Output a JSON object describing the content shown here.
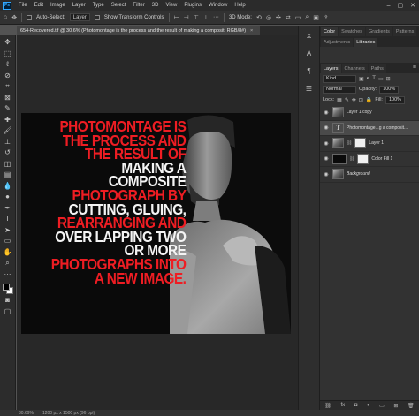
{
  "app": {
    "logo": "Ps"
  },
  "menu": [
    "File",
    "Edit",
    "Image",
    "Layer",
    "Type",
    "Select",
    "Filter",
    "3D",
    "View",
    "Plugins",
    "Window",
    "Help"
  ],
  "window_controls": {
    "minimize": "–",
    "maximize": "▢",
    "close": "✕"
  },
  "options_bar": {
    "auto_select_label": "Auto-Select:",
    "auto_select_value": "Layer",
    "show_transform": "Show Transform Controls",
    "mode_3d": "3D Mode:"
  },
  "document_tab": {
    "title": "654-Recovered.tif @ 30.6% (Photomontage is the process and the result of making a composit, RGB/8#)",
    "close": "×"
  },
  "poster": {
    "lines": [
      "PHOTOMONTAGE IS",
      "THE PROCESS AND",
      "THE RESULT OF",
      "MAKING A",
      "COMPOSITE",
      "PHOTOGRAPH BY",
      "CUTTING, GLUING,",
      "REARRANGING AND",
      "OVER LAPPING TWO",
      "OR MORE",
      "PHOTOGRAPHS INTO",
      "A NEW IMAGE."
    ]
  },
  "status": {
    "zoom": "30.69%",
    "size": "1200 px x 1500 px (96 ppi)"
  },
  "panel_top": {
    "tabs": [
      "Color",
      "Swatches",
      "Gradients",
      "Patterns"
    ],
    "subtabs": [
      "Adjustments",
      "Libraries"
    ]
  },
  "layers_panel": {
    "tabs": [
      "Layers",
      "Channels",
      "Paths"
    ],
    "kind": "Kind",
    "blend_mode": "Normal",
    "opacity_label": "Opacity:",
    "opacity_value": "100%",
    "lock_label": "Lock:",
    "fill_label": "Fill:",
    "fill_value": "100%",
    "layers": [
      {
        "name": "Layer 1 copy",
        "thumb": "photo",
        "selected": false
      },
      {
        "name": "Photomontage...g a composit...",
        "thumb": "text",
        "selected": true
      },
      {
        "name": "Layer 1",
        "thumb": "photo-mask",
        "selected": false
      },
      {
        "name": "Color Fill 1",
        "thumb": "black-mask",
        "selected": false
      },
      {
        "name": "Background",
        "thumb": "photo",
        "selected": false
      }
    ],
    "bottom_icons": [
      "link-icon",
      "fx-icon",
      "mask-icon",
      "adjustment-icon",
      "group-icon",
      "new-layer-icon",
      "trash-icon"
    ]
  },
  "colors": {
    "accent_red": "#ee1d23",
    "canvas_bg": "#282828",
    "chrome": "#323232"
  }
}
